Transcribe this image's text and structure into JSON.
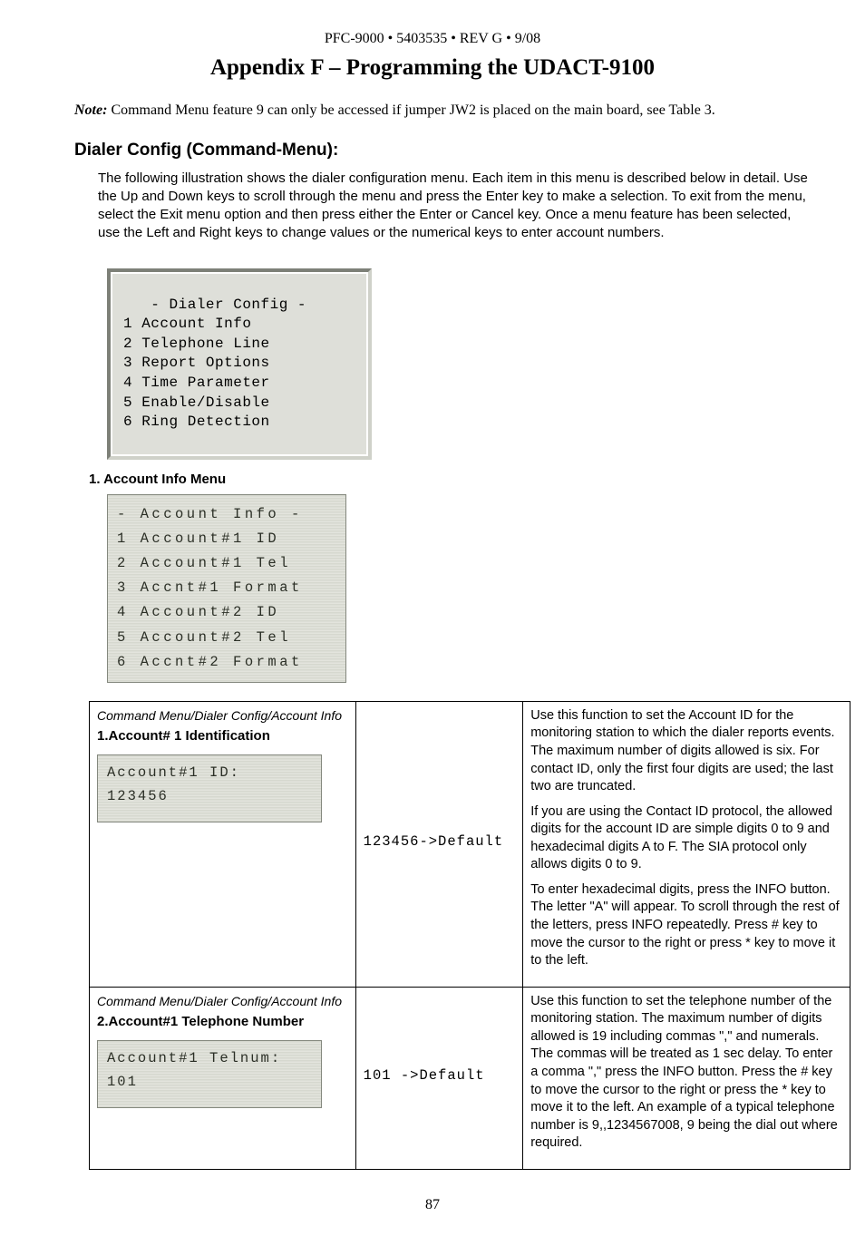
{
  "header": "PFC-9000 • 5403535 • REV G • 9/08",
  "appendix_title": "Appendix  F – Programming the UDACT-9100",
  "note": {
    "prefix": "Note:",
    "text": " Command Menu feature 9 can only be accessed if jumper JW2 is placed on the main board, see Table 3."
  },
  "section_title": "Dialer Config (Command-Menu):",
  "body_text": "The following illustration shows the dialer configuration menu. Each item in this menu is described below in detail. Use the Up and Down keys to scroll through the menu and press the Enter key to make a selection.  To exit from the menu, select the Exit menu option and then press either the Enter or Cancel key.  Once a menu feature has been selected, use the Left and Right keys to change values or the numerical keys to enter account numbers.",
  "dialer_menu": {
    "title": "   - Dialer Config -",
    "items": [
      "1 Account Info",
      "2 Telephone Line",
      "3 Report Options",
      "4 Time Parameter",
      "5 Enable/Disable",
      "6 Ring Detection"
    ]
  },
  "subhead_1": "1.  Account Info Menu",
  "lcd_menu": {
    "title": " - Account Info -",
    "items": [
      "1 Account#1 ID",
      "2 Account#1 Tel",
      "3 Accnt#1 Format",
      "4 Account#2 ID",
      "5 Account#2 Tel",
      "6 Accnt#2 Format"
    ]
  },
  "table": {
    "rows": [
      {
        "breadcrumb": "Command Menu/Dialer Config/Account Info",
        "title": "1.Account# 1 Identification",
        "lcd_line1": "Account#1 ID:",
        "lcd_line2": "123456",
        "mid": "123456->Default",
        "desc": [
          "Use this function to set the Account ID for the monitoring station to which the dialer reports events. The maximum number of digits allowed is six. For contact ID, only the first four digits are used; the last two are truncated.",
          "If you are using the Contact ID protocol, the allowed digits for the account ID are simple digits 0 to 9 and hexadecimal digits A to F. The SIA protocol only allows digits 0 to 9.",
          "To enter hexadecimal digits, press the INFO button. The letter \"A\" will appear. To scroll through the rest of the letters, press INFO repeatedly. Press # key to move the cursor to the right or press *  key to move it to the left."
        ]
      },
      {
        "breadcrumb": "Command Menu/Dialer Config/Account Info",
        "title": "2.Account#1 Telephone Number",
        "lcd_line1": "Account#1 Telnum:",
        "lcd_line2": "101",
        "mid": "101 ->Default",
        "desc": [
          "Use this function to set the telephone number of the monitoring station. The maximum number of digits allowed is 19 including commas \",\" and numerals. The commas will be treated as 1 sec delay. To enter a comma \",\" press the INFO button.  Press the # key to move the cursor to the right or press the * key to move it to the left. An example of a typical telephone number  is 9,,1234567008, 9 being the dial out where required."
        ]
      }
    ]
  },
  "page_num": "87"
}
